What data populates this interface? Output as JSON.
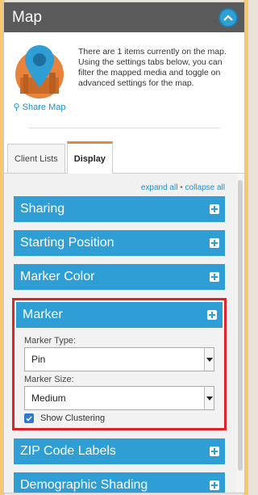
{
  "header": {
    "title": "Map"
  },
  "intro": {
    "description": "There are 1 items currently on the map. Using the settings tabs below, you can filter the mapped media and toggle on advanced settings for the map.",
    "share_label": "Share Map"
  },
  "tabs": [
    {
      "label": "Client Lists",
      "active": false
    },
    {
      "label": "Display",
      "active": true
    }
  ],
  "controls": {
    "expand_all": "expand all",
    "separator": "•",
    "collapse_all": "collapse all"
  },
  "sections": [
    {
      "label": "Sharing",
      "expanded": false
    },
    {
      "label": "Starting Position",
      "expanded": false
    },
    {
      "label": "Marker Color",
      "expanded": false
    },
    {
      "label": "Marker",
      "expanded": true
    },
    {
      "label": "ZIP Code Labels",
      "expanded": false
    },
    {
      "label": "Demographic Shading",
      "expanded": false
    }
  ],
  "marker": {
    "type_label": "Marker Type:",
    "type_value": "Pin",
    "size_label": "Marker Size:",
    "size_value": "Medium",
    "clustering_label": "Show Clustering",
    "clustering_checked": true
  },
  "colors": {
    "header": "#5a5a5a",
    "accent": "#2e9ed4",
    "highlight": "#e0222b",
    "tab_active": "#e8853c"
  }
}
